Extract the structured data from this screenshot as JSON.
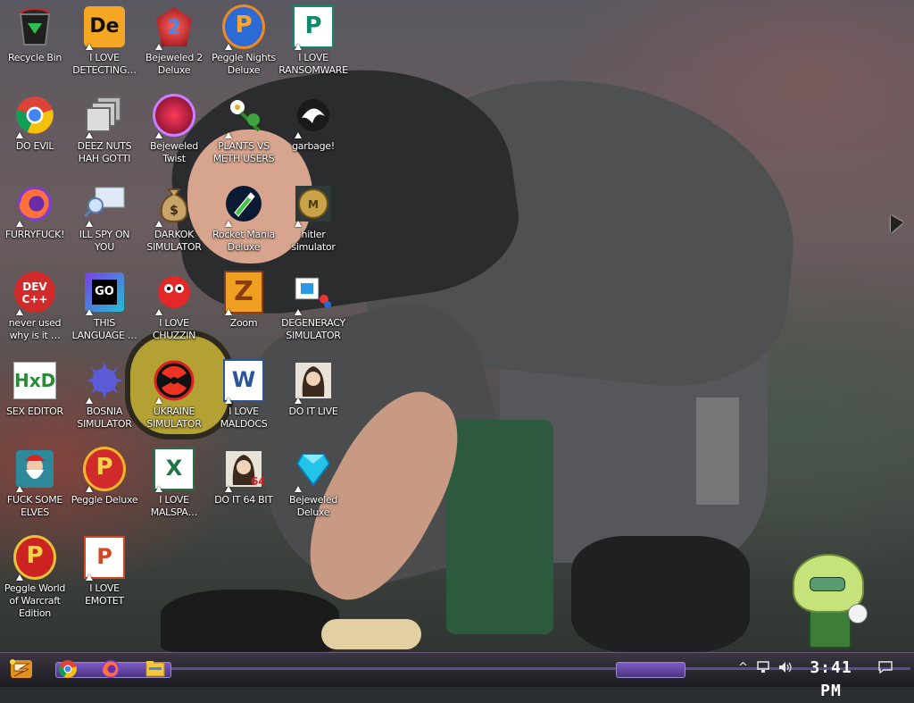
{
  "desktop": {
    "icons": [
      {
        "label": "Recycle Bin",
        "icon": "recycle-bin-icon",
        "shortcut": false
      },
      {
        "label": "I LOVE DETECTING…",
        "icon": "dxo-icon",
        "shortcut": true
      },
      {
        "label": "Bejeweled 2 Deluxe",
        "icon": "bejeweled-2-icon",
        "shortcut": true
      },
      {
        "label": "Peggle Nights Deluxe",
        "icon": "peggle-nights-icon",
        "shortcut": true
      },
      {
        "label": "I LOVE RANSOMWARE",
        "icon": "publisher-icon",
        "shortcut": true
      },
      {
        "label": "DO EVIL",
        "icon": "chrome-icon",
        "shortcut": true
      },
      {
        "label": "DEEZ NUTS HAH GOTTI",
        "icon": "stacked-windows-icon",
        "shortcut": true
      },
      {
        "label": "Bejeweled Twist",
        "icon": "bejeweled-twist-icon",
        "shortcut": true
      },
      {
        "label": "PLANTS VS METH USERS",
        "icon": "daisy-icon",
        "shortcut": true
      },
      {
        "label": "garbage!",
        "icon": "dragon-emblem-icon",
        "shortcut": true
      },
      {
        "label": "FURRYFUCK!",
        "icon": "firefox-icon",
        "shortcut": true
      },
      {
        "label": "ILL SPY ON YOU",
        "icon": "search-monitor-icon",
        "shortcut": true
      },
      {
        "label": "DARKOK SIMULATOR",
        "icon": "money-bag-icon",
        "shortcut": true
      },
      {
        "label": "Rocket Mania Deluxe",
        "icon": "rocket-icon",
        "shortcut": true
      },
      {
        "label": "hitler simulator",
        "icon": "coin-medal-icon",
        "shortcut": true
      },
      {
        "label": "never used why is it …",
        "icon": "dev-cpp-icon",
        "shortcut": true
      },
      {
        "label": "THIS LANGUAGE …",
        "icon": "goland-icon",
        "shortcut": true
      },
      {
        "label": "I LOVE CHUZZIN",
        "icon": "chuzzle-icon",
        "shortcut": true
      },
      {
        "label": "Zoom",
        "icon": "zuma-icon",
        "shortcut": true
      },
      {
        "label": "DEGENERACY SIMULATOR",
        "icon": "photo-app-icon",
        "shortcut": true
      },
      {
        "label": "SEX EDITOR",
        "icon": "hxd-icon",
        "shortcut": false
      },
      {
        "label": "BOSNIA SIMULATOR",
        "icon": "spiked-ball-icon",
        "shortcut": true
      },
      {
        "label": "UKRAINE SIMULATOR",
        "icon": "radiation-icon",
        "shortcut": true
      },
      {
        "label": "I LOVE MALDOCS",
        "icon": "word-icon",
        "shortcut": true
      },
      {
        "label": "DO IT LIVE",
        "icon": "portrait-icon",
        "shortcut": true
      },
      {
        "label": "FUCK SOME ELVES",
        "icon": "santa-icon",
        "shortcut": true
      },
      {
        "label": "Peggle Deluxe",
        "icon": "peggle-icon",
        "shortcut": true
      },
      {
        "label": "I LOVE MALSPA…",
        "icon": "excel-icon",
        "shortcut": true
      },
      {
        "label": "DO IT 64 BIT",
        "icon": "portrait-64-icon",
        "shortcut": true
      },
      {
        "label": "Bejeweled Deluxe",
        "icon": "diamond-icon",
        "shortcut": true
      },
      {
        "label": "Peggle World of Warcraft Edition",
        "icon": "peggle-wow-icon",
        "shortcut": true
      },
      {
        "label": "I LOVE EMOTET",
        "icon": "powerpoint-icon",
        "shortcut": true
      }
    ]
  },
  "taskbar": {
    "start": "start-icon",
    "pinned": [
      {
        "name": "chrome-taskbar-button",
        "icon": "chrome-icon"
      },
      {
        "name": "firefox-taskbar-button",
        "icon": "firefox-icon"
      },
      {
        "name": "file-explorer-taskbar-button",
        "icon": "folder-icon"
      }
    ],
    "tray": {
      "chevron": "^",
      "network": "network-icon",
      "volume": "volume-icon",
      "notifications": "notification-icon"
    },
    "clock": "3:41 PM"
  }
}
